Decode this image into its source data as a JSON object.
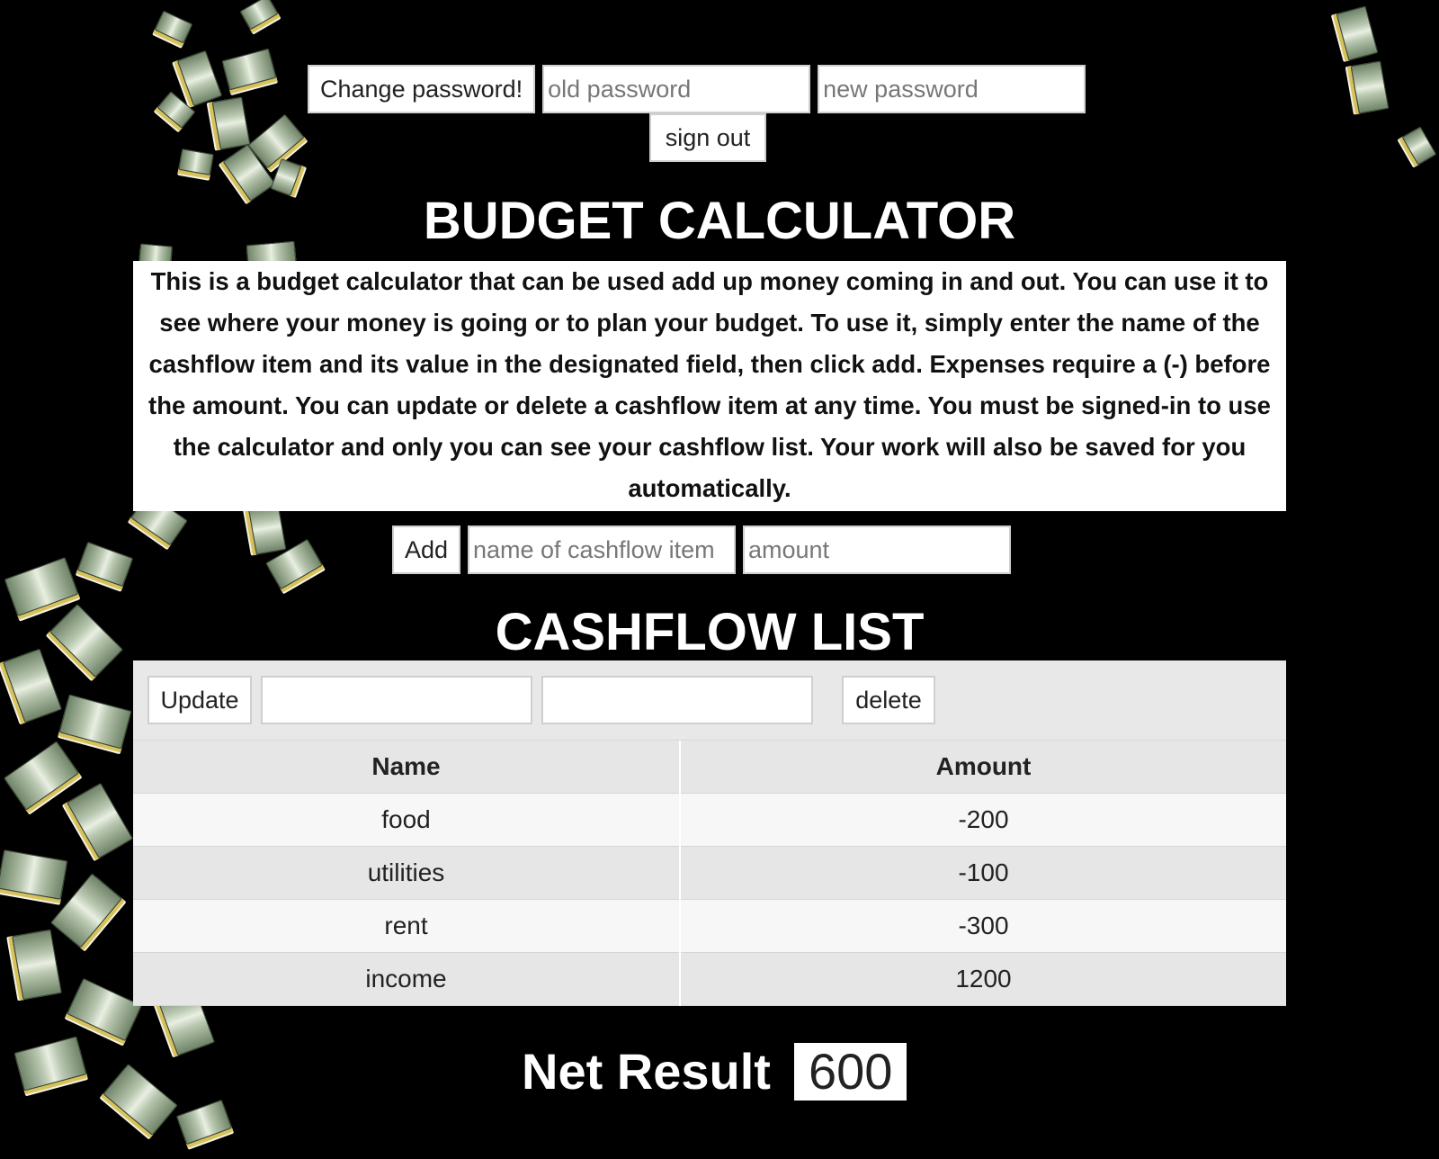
{
  "auth": {
    "change_password_label": "Change password!",
    "old_password_placeholder": "old password",
    "new_password_placeholder": "new password",
    "sign_out_label": "sign out"
  },
  "header": {
    "title": "BUDGET CALCULATOR",
    "description": "This is a budget calculator that can be used add up money coming in and out. You can use it to see where your money is going or to plan your budget. To use it, simply enter the name of the cashflow item and its value in the designated field, then click add. Expenses require a (-) before the amount. You can update or delete a cashflow item at any time. You must be signed-in to use the calculator and only you can see your cashflow list. Your work will also be saved for you automatically."
  },
  "add_form": {
    "add_label": "Add",
    "name_placeholder": "name of cashflow item",
    "amount_placeholder": "amount"
  },
  "cashflow": {
    "title": "CASHFLOW LIST",
    "update_label": "Update",
    "update_name_value": "",
    "update_amount_value": "",
    "delete_label": "delete",
    "columns": [
      "Name",
      "Amount"
    ],
    "rows": [
      {
        "name": "food",
        "amount": "-200"
      },
      {
        "name": "utilities",
        "amount": "-100"
      },
      {
        "name": "rent",
        "amount": "-300"
      },
      {
        "name": "income",
        "amount": "1200"
      }
    ]
  },
  "result": {
    "label": "Net Result",
    "value": "600"
  },
  "colors": {
    "background": "#000000",
    "panel": "#e8e8e8",
    "text": "#222222",
    "heading": "#ffffff"
  }
}
